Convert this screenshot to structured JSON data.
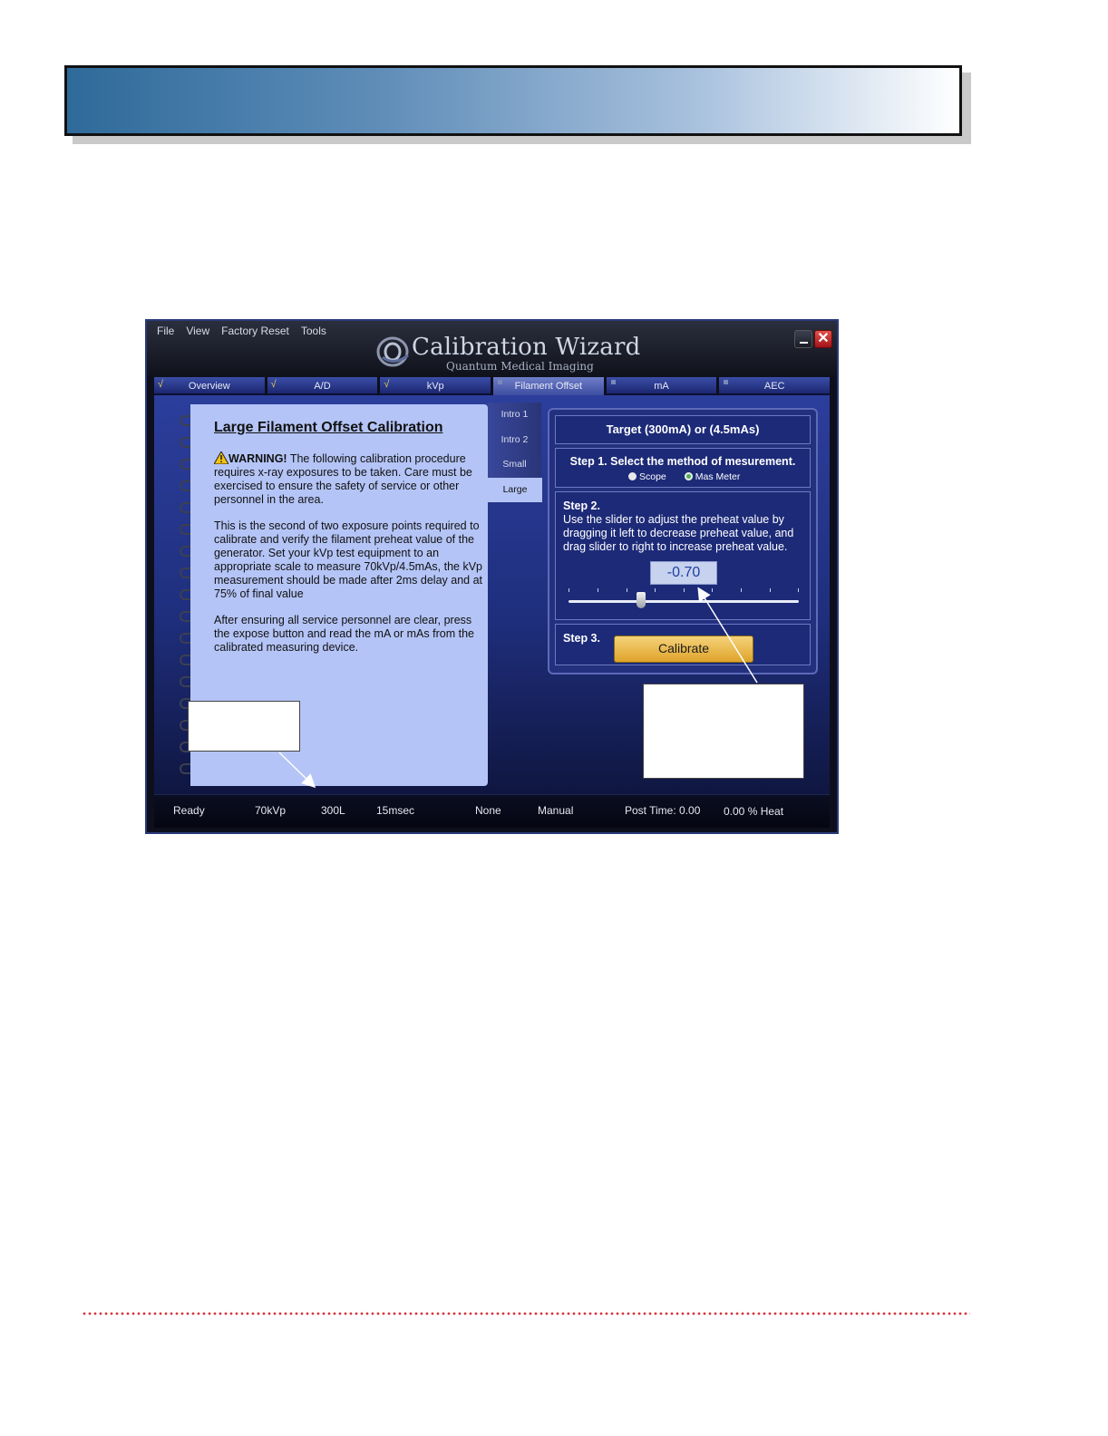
{
  "menu": {
    "file": "File",
    "view": "View",
    "factory_reset": "Factory Reset",
    "tools": "Tools"
  },
  "app": {
    "title": "Calibration Wizard",
    "subtitle": "Quantum Medical Imaging",
    "close_glyph": "✕"
  },
  "tabs": [
    {
      "label": "Overview",
      "mark": "√"
    },
    {
      "label": "A/D",
      "mark": "√"
    },
    {
      "label": "kVp",
      "mark": "√"
    },
    {
      "label": "Filament Offset",
      "mark": ""
    },
    {
      "label": "mA",
      "mark": ""
    },
    {
      "label": "AEC",
      "mark": ""
    }
  ],
  "notebook": {
    "title": "Large Filament Offset Calibration",
    "warning_label": "WARNING!",
    "warning_text": " The following calibration procedure requires x-ray exposures to be taken.  Care must be exercised to ensure the safety of service or other personnel in the area.",
    "para2": "This is the second of two exposure points required to calibrate and verify the filament preheat value of the generator.  Set your kVp test equipment to an appropriate scale to measure 70kVp/4.5mAs, the kVp measurement should be made after 2ms delay and at 75% of final value",
    "para3": "After ensuring all service personnel are clear, press the expose button and read the mA or mAs from the calibrated measuring device."
  },
  "subtabs": [
    "Intro 1",
    "Intro 2",
    "Small",
    "Large"
  ],
  "panel": {
    "target": "Target (300mA) or (4.5mAs)",
    "step1_title": "Step 1. Select the method of mesurement.",
    "radio_scope": "Scope",
    "radio_mas": "Mas Meter",
    "step2_title": "Step 2.",
    "step2_text": "Use the slider to adjust the preheat value by dragging it left to decrease preheat value, and drag slider to right to increase preheat value.",
    "value": "-0.70",
    "step3_title": "Step 3.",
    "calibrate": "Calibrate"
  },
  "status": {
    "ready": "Ready",
    "kvp": "70kVp",
    "ma": "300L",
    "time": "15msec",
    "none": "None",
    "mode": "Manual",
    "post_time": "Post Time: 0.00",
    "heat": "0.00 % Heat"
  },
  "colors": {
    "accent": "#1f2f7e",
    "calibrate": "#dfa42a",
    "footer_dots": "#d9323a"
  }
}
